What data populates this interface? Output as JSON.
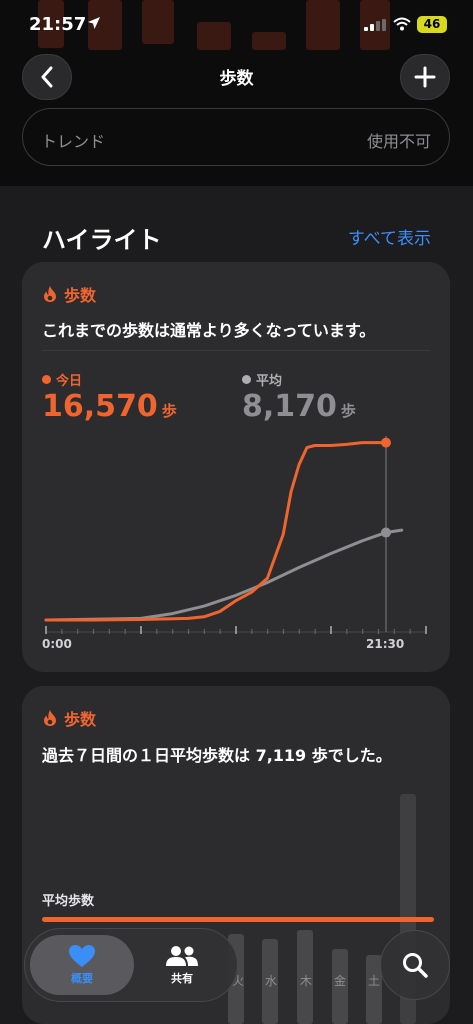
{
  "status_bar": {
    "time": "21:57",
    "battery": "46"
  },
  "nav": {
    "title": "歩数"
  },
  "trend": {
    "label": "トレンド",
    "value": "使用不可"
  },
  "highlights": {
    "title": "ハイライト",
    "show_all": "すべて表示"
  },
  "card1": {
    "category": "歩数",
    "headline": "これまでの歩数は通常より多くなっています。",
    "today_label": "今日",
    "today_value": "16,570",
    "today_unit": "歩",
    "avg_label": "平均",
    "avg_value": "8,170",
    "avg_unit": "歩",
    "x_start": "0:00",
    "x_end": "21:30",
    "colors": {
      "today": "#f0652f",
      "average": "#8e8e93"
    }
  },
  "card2": {
    "category": "歩数",
    "headline": "過去７日間の１日平均歩数は 7,119 歩でした。",
    "avg_label": "平均歩数",
    "days": [
      "火",
      "水",
      "木",
      "金",
      "土"
    ]
  },
  "tabbar": {
    "summary": "概要",
    "sharing": "共有"
  },
  "chart_data": {
    "type": "line",
    "x_start": "0:00",
    "x_end": "21:30",
    "series": [
      {
        "name": "今日",
        "color": "#f0652f",
        "x": [
          0,
          3,
          6,
          9,
          10,
          11,
          12,
          13,
          14,
          15,
          15.5,
          16,
          16.5,
          17,
          18,
          19,
          20,
          21.5
        ],
        "y": [
          0,
          0,
          50,
          150,
          300,
          800,
          1800,
          2600,
          3900,
          8000,
          12000,
          14500,
          16100,
          16300,
          16300,
          16400,
          16570,
          16570
        ]
      },
      {
        "name": "平均",
        "color": "#8e8e93",
        "x": [
          0,
          6,
          8,
          10,
          12,
          14,
          16,
          18,
          20,
          21.5,
          22.5
        ],
        "y": [
          0,
          150,
          600,
          1300,
          2300,
          3500,
          4900,
          6200,
          7400,
          8170,
          8400
        ]
      }
    ],
    "ylim": [
      0,
      17000
    ]
  }
}
